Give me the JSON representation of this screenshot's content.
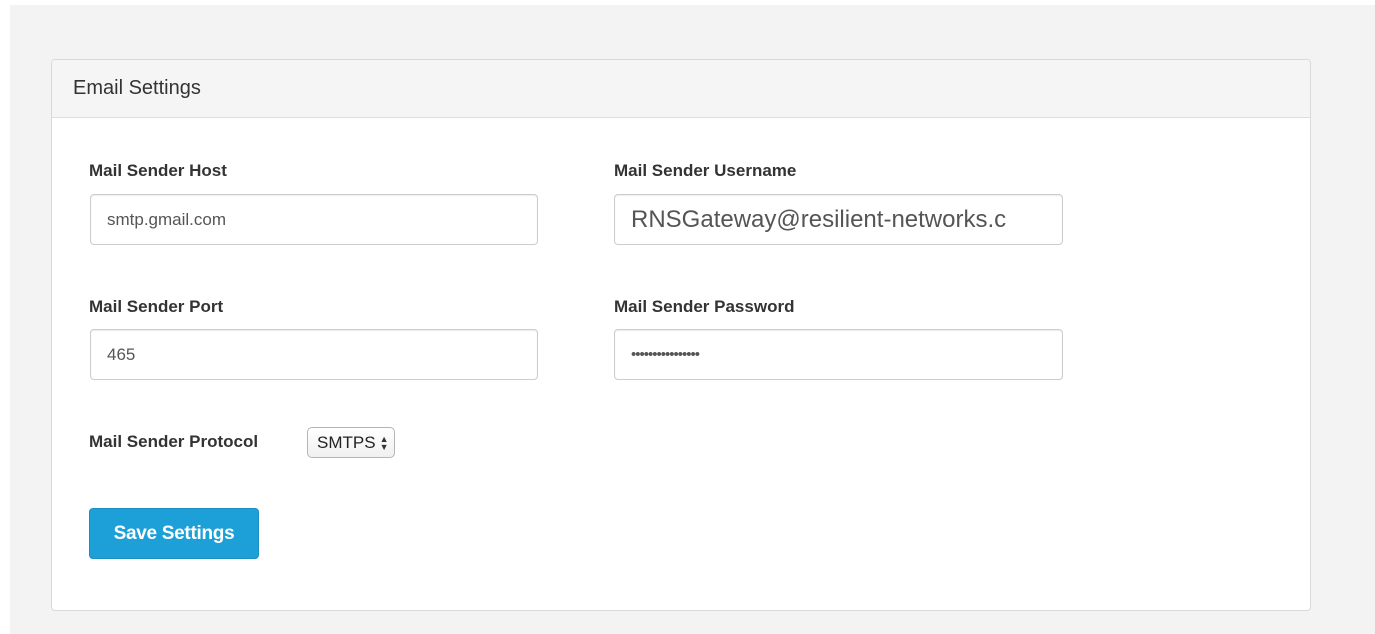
{
  "panel": {
    "title": "Email Settings"
  },
  "fields": {
    "host": {
      "label": "Mail Sender Host",
      "value": "smtp.gmail.com"
    },
    "username": {
      "label": "Mail Sender Username",
      "value": "RNSGateway@resilient-networks.c"
    },
    "port": {
      "label": "Mail Sender Port",
      "value": "465"
    },
    "password": {
      "label": "Mail Sender Password",
      "value": "••••••••••••••••"
    },
    "protocol": {
      "label": "Mail Sender Protocol",
      "selected": "SMTPS"
    }
  },
  "actions": {
    "save_label": "Save Settings"
  },
  "colors": {
    "primary_button": "#1da0d8",
    "panel_heading_bg": "#f5f5f5"
  }
}
